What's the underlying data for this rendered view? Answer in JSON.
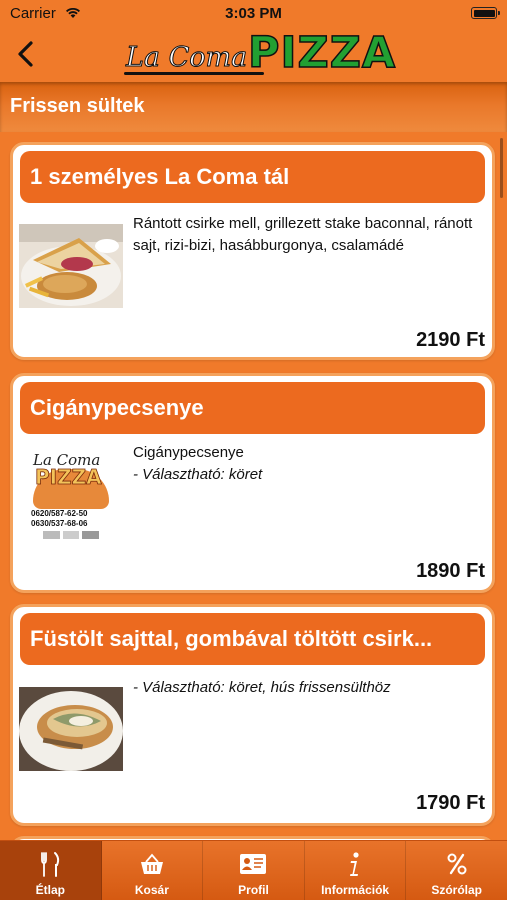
{
  "status": {
    "carrier": "Carrier",
    "time": "3:03 PM"
  },
  "nav": {
    "logo_script": "La Coma",
    "logo_pizza": "PIZZA"
  },
  "section": {
    "title": "Frissen sültek"
  },
  "items": [
    {
      "title": "1 személyes La Coma tál",
      "description": "Rántott csirke mell, grillezett stake baconnal, ránott sajt, rizi-bizi, hasábburgonya, csalamádé",
      "option": "",
      "price": "2190 Ft"
    },
    {
      "title": "Cigánypecsenye",
      "description": "Cigánypecsenye",
      "option": " - Választható: köret",
      "price": "1890 Ft",
      "placeholder_logo": {
        "script": "La Coma",
        "word": "PIZZA",
        "phone1": "0620/587-62-50",
        "phone2": "0630/537-68-06"
      }
    },
    {
      "title": "Füstölt sajttal, gombával töltött csirk...",
      "description": "",
      "option": " - Választható: köret, hús frissensülthöz",
      "price": "1790 Ft"
    }
  ],
  "tabs": [
    {
      "label": "Étlap",
      "icon": "fork-knife-icon",
      "active": true
    },
    {
      "label": "Kosár",
      "icon": "basket-icon",
      "active": false
    },
    {
      "label": "Profil",
      "icon": "profile-card-icon",
      "active": false
    },
    {
      "label": "Információk",
      "icon": "info-icon",
      "active": false
    },
    {
      "label": "Szórólap",
      "icon": "percent-icon",
      "active": false
    }
  ],
  "colors": {
    "brand_orange": "#f07a2a",
    "title_bar": "#ec6a1f",
    "logo_green": "#22a032",
    "active_tab": "#a8420c"
  }
}
